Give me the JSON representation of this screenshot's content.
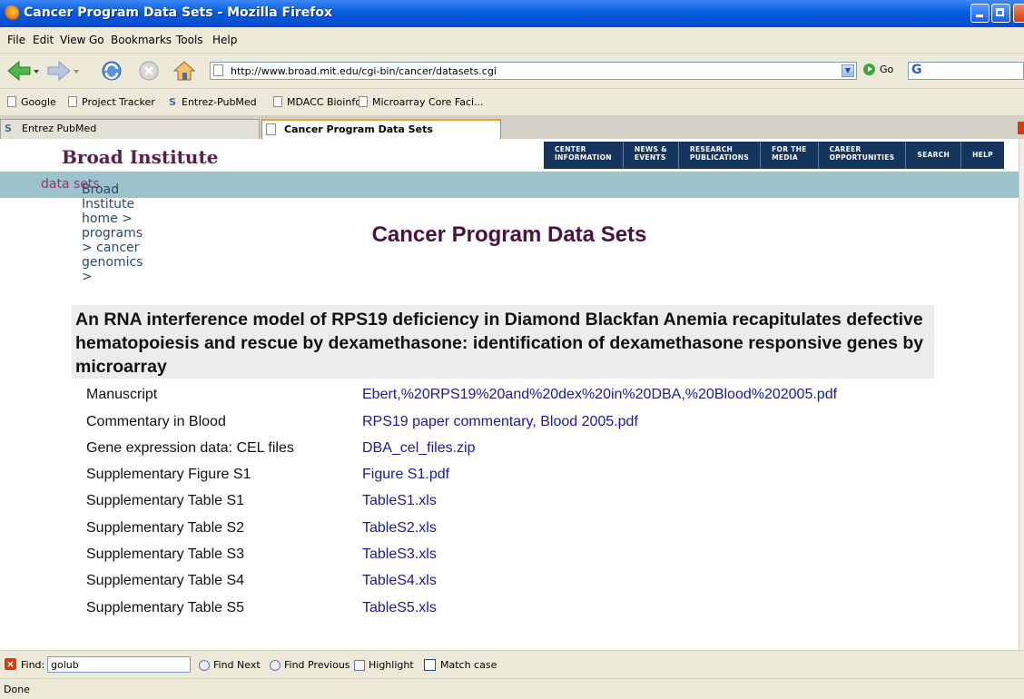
{
  "window": {
    "title": "Cancer Program Data Sets - Mozilla Firefox"
  },
  "menu": [
    "File",
    "Edit",
    "View",
    "Go",
    "Bookmarks",
    "Tools",
    "Help"
  ],
  "navigation": {
    "url": "http://www.broad.mit.edu/cgi-bin/cancer/datasets.cgi",
    "go_label": "Go"
  },
  "bookmarks": [
    "Google",
    "Project Tracker",
    "Entrez-PubMed",
    "MDACC Bioinfo",
    "Microarray Core Faci..."
  ],
  "tabs": [
    "Entrez PubMed",
    "Cancer Program Data Sets"
  ],
  "site": {
    "brand": "Broad Institute",
    "nav": [
      {
        "line1": "CENTER",
        "line2": "INFORMATION"
      },
      {
        "line1": "NEWS &",
        "line2": "EVENTS"
      },
      {
        "line1": "RESEARCH",
        "line2": "PUBLICATIONS"
      },
      {
        "line1": "FOR THE",
        "line2": "MEDIA"
      },
      {
        "line1": "CAREER",
        "line2": "OPPORTUNITIES"
      },
      {
        "line1": "SEARCH",
        "line2": ""
      },
      {
        "line1": "HELP",
        "line2": ""
      }
    ],
    "breadcrumb": {
      "path": "Broad Institute home > programs > cancer genomics > ",
      "current": "data sets"
    }
  },
  "page": {
    "title": "Cancer Program Data Sets",
    "dataset_title": "An RNA interference model of RPS19 deficiency in Diamond Blackfan Anemia recapitulates defective hematopoiesis and rescue by dexamethasone: identification of dexamethasone responsive genes by microarray",
    "rows": [
      {
        "label": "Manuscript",
        "link": "Ebert,%20RPS19%20and%20dex%20in%20DBA,%20Blood%202005.pdf"
      },
      {
        "label": "Commentary in Blood",
        "link": "RPS19 paper commentary, Blood 2005.pdf"
      },
      {
        "label": "Gene expression data: CEL files",
        "link": "DBA_cel_files.zip"
      },
      {
        "label": "Supplementary Figure S1",
        "link": "Figure S1.pdf"
      },
      {
        "label": "Supplementary Table S1",
        "link": "TableS1.xls"
      },
      {
        "label": "Supplementary Table S2",
        "link": "TableS2.xls"
      },
      {
        "label": "Supplementary Table S3",
        "link": "TableS3.xls"
      },
      {
        "label": "Supplementary Table S4",
        "link": "TableS4.xls"
      },
      {
        "label": "Supplementary Table S5",
        "link": "TableS5.xls"
      }
    ]
  },
  "findbar": {
    "label": "Find:",
    "value": "golub",
    "find_next": "Find Next",
    "find_previous": "Find Previous",
    "highlight": "Highlight",
    "match_case": "Match case"
  },
  "status": "Done"
}
